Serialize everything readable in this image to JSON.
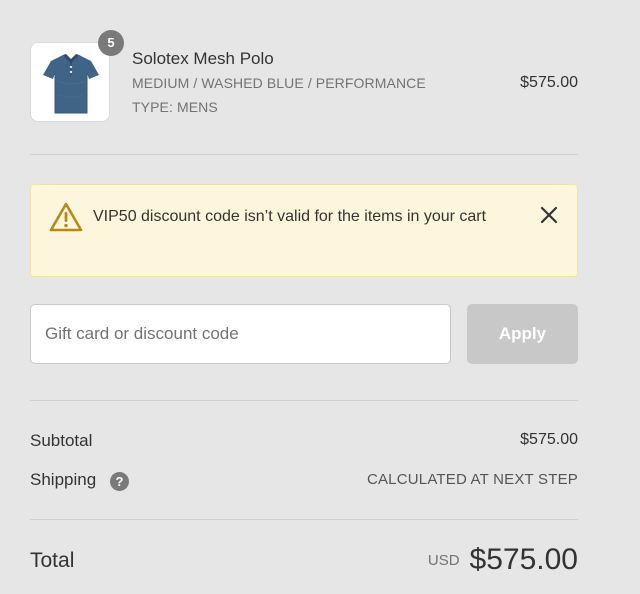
{
  "product": {
    "name": "Solotex Mesh Polo",
    "variant": "MEDIUM / WASHED BLUE / PERFORMANCE",
    "type": "TYPE: MENS",
    "price": "$575.00",
    "quantity": "5",
    "image_icon": "polo-shirt-icon",
    "shirt_color": "#3f6485"
  },
  "notice": {
    "message": "VIP50 discount code isn’t valid for the items in your cart",
    "icon": "warning-icon",
    "background": "#fdf6dc",
    "icon_color": "#b58a1b"
  },
  "discount": {
    "placeholder": "Gift card or discount code",
    "apply_label": "Apply"
  },
  "summary": {
    "subtotal_label": "Subtotal",
    "subtotal_value": "$575.00",
    "shipping_label": "Shipping",
    "shipping_help": "?",
    "shipping_value": "CALCULATED AT NEXT STEP",
    "total_label": "Total",
    "total_currency": "USD",
    "total_value": "$575.00"
  }
}
